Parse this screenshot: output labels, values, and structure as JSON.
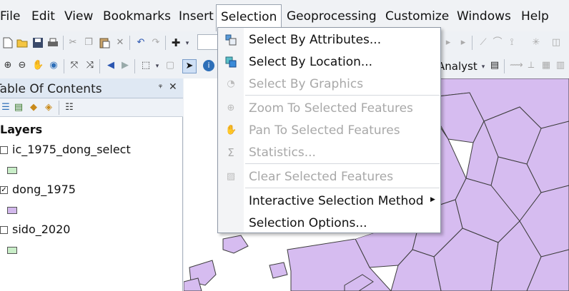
{
  "menubar": {
    "items": [
      "File",
      "Edit",
      "View",
      "Bookmarks",
      "Insert",
      "Selection",
      "Geoprocessing",
      "Customize",
      "Windows",
      "Help"
    ]
  },
  "toolbar": {
    "analyst_label": "Analyst"
  },
  "toc": {
    "title": "Table Of Contents",
    "layers_heading": "Layers",
    "layers": [
      {
        "name": "ic_1975_dong_select",
        "checked": false,
        "swatch": "#c9eec8"
      },
      {
        "name": "dong_1975",
        "checked": true,
        "swatch": "#d2b8ec"
      },
      {
        "name": "sido_2020",
        "checked": false,
        "swatch": "#c9eec8"
      }
    ]
  },
  "map": {
    "fill_color": "#d6bcf0",
    "line_color": "#3d3d3d"
  },
  "selection_menu": {
    "items": [
      {
        "label": "Select By Attributes...",
        "enabled": true,
        "icon": "select-by-attributes-icon"
      },
      {
        "label": "Select By Location...",
        "enabled": true,
        "icon": "select-by-location-icon"
      },
      {
        "label": "Select By Graphics",
        "enabled": false,
        "icon": "select-by-graphics-icon"
      },
      {
        "label": "Zoom To Selected Features",
        "enabled": false,
        "icon": "zoom-to-selected-icon"
      },
      {
        "label": "Pan To Selected Features",
        "enabled": false,
        "icon": "pan-to-selected-icon"
      },
      {
        "label": "Statistics...",
        "enabled": false,
        "icon": "statistics-sigma-icon"
      },
      {
        "label": "Clear Selected Features",
        "enabled": false,
        "icon": "clear-selection-icon"
      },
      {
        "label": "Interactive Selection Method",
        "enabled": true,
        "submenu": true
      },
      {
        "label": "Selection Options...",
        "enabled": true
      }
    ]
  }
}
